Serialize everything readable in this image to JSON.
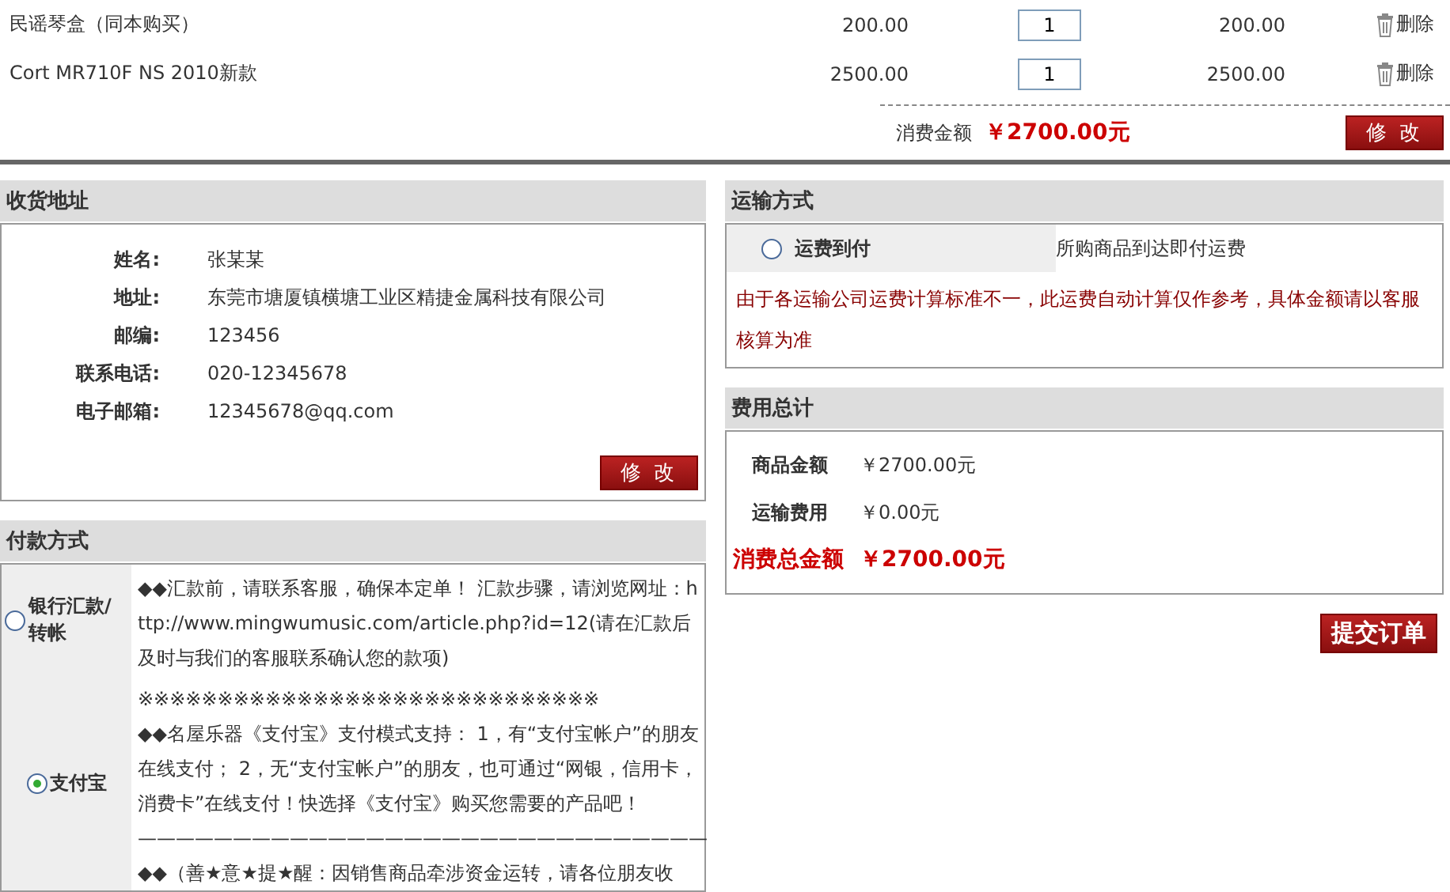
{
  "cart": {
    "rows": [
      {
        "name": "民谣琴盒（同本购买）",
        "price": "200.00",
        "quantity": "1",
        "subtotal": "200.00",
        "delete_label": "删除"
      },
      {
        "name": "Cort MR710F NS 2010新款",
        "price": "2500.00",
        "quantity": "1",
        "subtotal": "2500.00",
        "delete_label": "删除"
      }
    ],
    "total_label": "消费金额",
    "total_value": "￥2700.00元",
    "edit_button": "修 改"
  },
  "address": {
    "title": "收货地址",
    "fields": [
      {
        "label": "姓名:",
        "value": "张某某"
      },
      {
        "label": "地址:",
        "value": "东莞市塘厦镇横塘工业区精捷金属科技有限公司"
      },
      {
        "label": "邮编:",
        "value": "123456"
      },
      {
        "label": "联系电话:",
        "value": "020-12345678"
      },
      {
        "label": "电子邮箱:",
        "value": "12345678@qq.com"
      }
    ],
    "edit_button": "修 改"
  },
  "payment": {
    "title": "付款方式",
    "options": [
      {
        "label": "银行汇款/转帐",
        "selected": false,
        "lines": [
          "◆◆汇款前，请联系客服，确保本定单！ 汇款步骤，请浏览网址：http://www.mingwumusic.com/article.php?id=12(请在汇款后及时与我们的客服联系确认您的款项)"
        ]
      },
      {
        "label": "支付宝",
        "selected": true,
        "lines": [
          "※※※※※※※※※※※※※※※※※※※※※※※※※※※※※",
          "◆◆名屋乐器《支付宝》支付模式支持： 1，有“支付宝帐户”的朋友在线支付； 2，无“支付宝帐户”的朋友，也可通过“网银，信用卡，消费卡”在线支付！快选择《支付宝》购买您需要的产品吧！",
          "——————————————————————————————",
          "◆◆（善★意★提★醒：因销售商品牵涉资金运转，请各位朋友收"
        ]
      }
    ]
  },
  "shipping": {
    "title": "运输方式",
    "options": [
      {
        "label": "运费到付",
        "selected": false,
        "description": "所购商品到达即付运费"
      }
    ],
    "note": "由于各运输公司运费计算标准不一，此运费自动计算仅作参考，具体金额请以客服核算为准"
  },
  "costs": {
    "title": "费用总计",
    "items": [
      {
        "label": "商品金额",
        "value": "￥2700.00元"
      },
      {
        "label": "运输费用",
        "value": "￥0.00元"
      }
    ],
    "total_label": "消费总金额",
    "total_value": "￥2700.00元"
  },
  "submit_button": "提交订单"
}
